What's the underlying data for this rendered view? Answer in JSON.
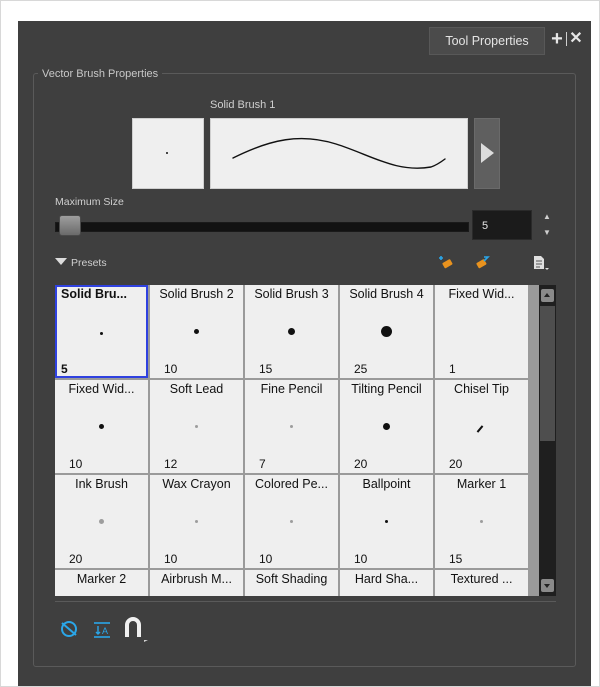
{
  "panel": {
    "tab_label": "Tool Properties",
    "tab_plus": "+",
    "tab_close": "✕",
    "group_label": "Vector Brush Properties"
  },
  "brush": {
    "name": "Solid Brush 1",
    "max_size_label": "Maximum Size",
    "max_size_value": "5",
    "slider_level_fraction": 0.05
  },
  "presets": {
    "label": "Presets",
    "toolbar_icons": [
      "new-brush-icon",
      "rename-brush-icon",
      "presets-menu-icon"
    ],
    "items": [
      {
        "name": "Solid Bru...",
        "size": "5",
        "dot": 1,
        "selected": true
      },
      {
        "name": "Solid Brush 2",
        "size": "10",
        "dot": 2
      },
      {
        "name": "Solid Brush 3",
        "size": "15",
        "dot": 3
      },
      {
        "name": "Solid Brush 4",
        "size": "25",
        "dot": 5
      },
      {
        "name": "Fixed Wid...",
        "size": "1",
        "dot": 0
      },
      {
        "name": "Fixed Wid...",
        "size": "10",
        "dot": 2
      },
      {
        "name": "Soft Lead",
        "size": "12",
        "dot": 1,
        "soft": true
      },
      {
        "name": "Fine Pencil",
        "size": "7",
        "dot": 1,
        "soft": true
      },
      {
        "name": "Tilting Pencil",
        "size": "20",
        "dot": 3
      },
      {
        "name": "Chisel Tip",
        "size": "20",
        "chisel": true
      },
      {
        "name": "Ink Brush",
        "size": "20",
        "dot": 2,
        "soft": true
      },
      {
        "name": "Wax Crayon",
        "size": "10",
        "dot": 1,
        "soft": true
      },
      {
        "name": "Colored Pe...",
        "size": "10",
        "dot": 1,
        "soft": true
      },
      {
        "name": "Ballpoint",
        "size": "10",
        "dot": 1
      },
      {
        "name": "Marker 1",
        "size": "15",
        "dot": 1,
        "soft": true
      },
      {
        "name": "Marker 2",
        "size": ""
      },
      {
        "name": "Airbrush M...",
        "size": ""
      },
      {
        "name": "Soft Shading",
        "size": ""
      },
      {
        "name": "Hard Sha...",
        "size": ""
      },
      {
        "name": "Textured ...",
        "size": ""
      }
    ]
  },
  "bottom_toolbar": {
    "icons": [
      "smoothing-icon",
      "text-size-icon",
      "magnet-icon"
    ]
  },
  "colors": {
    "panel_bg": "#3f3f3f",
    "selection_border": "#2f41e0",
    "accent_blue": "#2aa6e8"
  }
}
